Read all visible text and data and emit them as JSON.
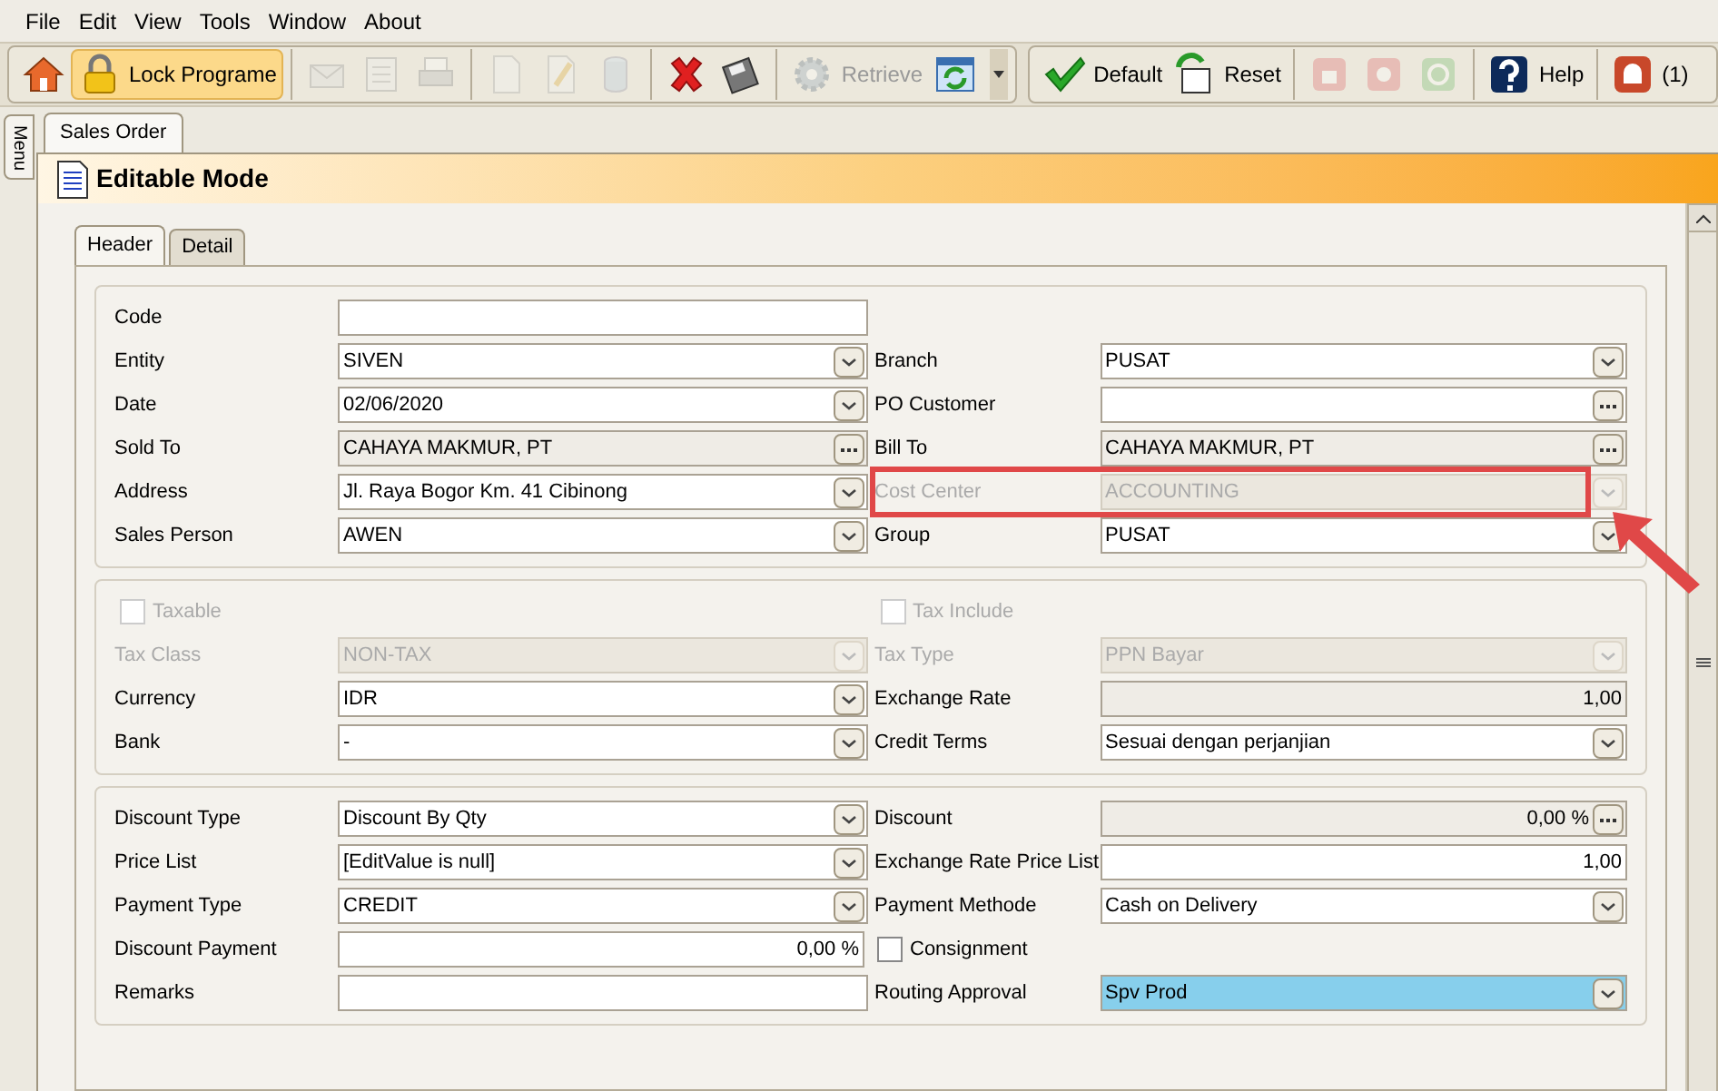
{
  "menu": [
    "File",
    "Edit",
    "View",
    "Tools",
    "Window",
    "About"
  ],
  "toolbar": [
    {
      "disabled": false,
      "active": false
    },
    {
      "label": "Lock Programe",
      "disabled": false,
      "active": true
    },
    {
      "disabled": true,
      "active": false
    },
    {
      "disabled": true,
      "active": false
    },
    {
      "disabled": true,
      "active": false
    },
    {
      "disabled": true,
      "active": false
    },
    {
      "disabled": true,
      "active": false
    },
    {
      "disabled": true,
      "active": false
    },
    {
      "disabled": false,
      "active": false
    },
    {
      "disabled": false,
      "active": false
    },
    {
      "label": "Retrieve",
      "disabled": true,
      "active": false
    },
    {
      "disabled": false,
      "active": false
    }
  ],
  "toolbar2": [
    {
      "label": "Default",
      "disabled": false
    },
    {
      "label": "Reset",
      "disabled": false
    },
    {
      "disabled": true
    },
    {
      "disabled": true
    },
    {
      "disabled": true
    },
    {
      "label": "Help",
      "disabled": false
    },
    {
      "label": "(1)",
      "disabled": false
    }
  ],
  "side_tab": "Menu",
  "doc_tabs": [
    {
      "label": "Sales Order",
      "selected": true
    }
  ],
  "mode_title": "Editable Mode",
  "form_tabs": [
    {
      "label": "Header",
      "selected": true
    },
    {
      "label": "Detail",
      "selected": false
    }
  ],
  "sections": [
    [
      {
        "left": {
          "kind": "text",
          "label": "Code",
          "readonly": false,
          "disabled": false
        }
      },
      {
        "left": {
          "kind": "combo",
          "label": "Entity",
          "value": "SIVEN",
          "readonly": false,
          "disabled": false
        },
        "right": {
          "kind": "combo",
          "label": "Branch",
          "value": "PUSAT",
          "readonly": false,
          "disabled": false
        }
      },
      {
        "left": {
          "kind": "combo",
          "label": "Date",
          "value": "02/06/2020",
          "readonly": false,
          "disabled": false
        },
        "right": {
          "kind": "lookup",
          "label": "PO Customer",
          "readonly": false,
          "disabled": false
        }
      },
      {
        "left": {
          "kind": "lookup",
          "label": "Sold To",
          "value": "CAHAYA MAKMUR, PT",
          "readonly": true,
          "disabled": false
        },
        "right": {
          "kind": "lookup",
          "label": "Bill To",
          "value": "CAHAYA MAKMUR, PT",
          "readonly": true,
          "disabled": false
        }
      },
      {
        "left": {
          "kind": "combo",
          "label": "Address",
          "value": "Jl. Raya Bogor Km. 41 Cibinong",
          "readonly": false,
          "disabled": false
        },
        "right": {
          "kind": "combo",
          "label": "Cost Center",
          "value": "ACCOUNTING",
          "disabled": true,
          "highlighted": true
        }
      },
      {
        "left": {
          "kind": "combo",
          "label": "Sales Person",
          "value": "AWEN",
          "readonly": false,
          "disabled": false
        },
        "right": {
          "kind": "combo",
          "label": "Group",
          "value": "PUSAT",
          "readonly": false,
          "disabled": false
        }
      }
    ],
    [
      {
        "left": {
          "kind": "checkbox",
          "label": "Taxable",
          "checked": false,
          "disabled": true
        },
        "right": {
          "kind": "checkbox",
          "label": "Tax Include",
          "checked": false,
          "disabled": true
        }
      },
      {
        "left": {
          "kind": "combo",
          "label": "Tax Class",
          "value": "NON-TAX",
          "disabled": true
        },
        "right": {
          "kind": "combo",
          "label": "Tax Type",
          "value": "PPN Bayar",
          "disabled": true
        }
      },
      {
        "left": {
          "kind": "combo",
          "label": "Currency",
          "value": "IDR",
          "readonly": false,
          "disabled": false
        },
        "right": {
          "kind": "number",
          "label": "Exchange Rate",
          "value": "1,00",
          "readonly": true,
          "disabled": false
        }
      },
      {
        "left": {
          "kind": "combo",
          "label": "Bank",
          "value": "-",
          "readonly": false,
          "disabled": false
        },
        "right": {
          "kind": "combo",
          "label": "Credit Terms",
          "value": "Sesuai dengan perjanjian",
          "readonly": false,
          "disabled": false
        }
      }
    ],
    [
      {
        "left": {
          "kind": "combo",
          "label": "Discount Type",
          "value": "Discount By Qty",
          "readonly": false,
          "disabled": false
        },
        "right": {
          "kind": "numberlookup",
          "label": "Discount",
          "value": "0,00 %",
          "readonly": true,
          "disabled": false
        }
      },
      {
        "left": {
          "kind": "combo",
          "label": "Price List",
          "value": "[EditValue is null]",
          "readonly": false,
          "disabled": false
        },
        "right": {
          "kind": "number",
          "label": "Exchange Rate Price List",
          "value": "1,00",
          "readonly": false,
          "disabled": false
        }
      },
      {
        "left": {
          "kind": "combo",
          "label": "Payment Type",
          "value": "CREDIT",
          "readonly": false,
          "disabled": false
        },
        "right": {
          "kind": "combo",
          "label": "Payment Methode",
          "value": "Cash on Delivery",
          "readonly": false,
          "disabled": false
        }
      },
      {
        "left": {
          "kind": "number",
          "label": "Discount Payment",
          "value": "0,00 %",
          "readonly": false,
          "disabled": false
        },
        "right": {
          "kind": "checkbox",
          "label": "Consignment",
          "checked": false,
          "disabled": false
        }
      },
      {
        "left": {
          "kind": "text",
          "label": "Remarks",
          "readonly": false,
          "disabled": false
        },
        "right": {
          "kind": "combo",
          "label": "Routing Approval",
          "value": "Spv Prod",
          "disabled": false,
          "focused": true
        }
      }
    ]
  ]
}
